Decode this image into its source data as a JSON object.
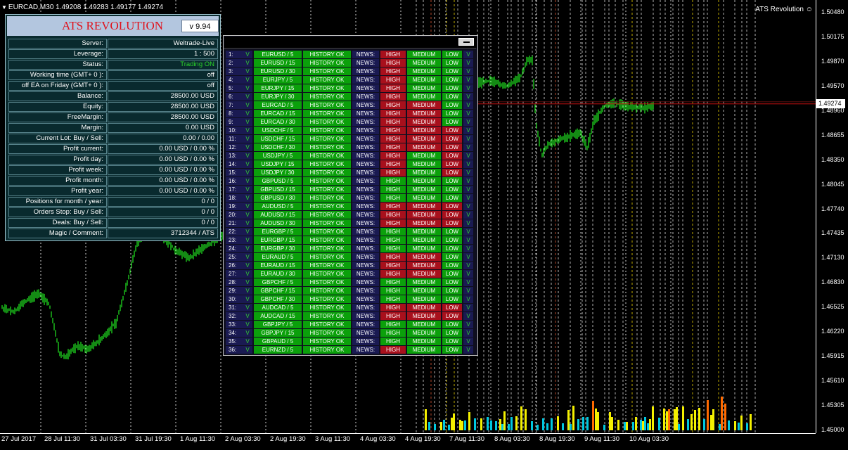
{
  "chart": {
    "symbol_title": "EURCAD,M30  1.49208 1.49283 1.49177 1.49274",
    "indicator_name": "ATS Revolution",
    "indicator_icon": "smiley-icon",
    "current_price": "1.49274",
    "price_labels": [
      "1.50480",
      "1.50175",
      "1.49870",
      "1.49570",
      "1.48960",
      "1.48655",
      "1.48350",
      "1.48045",
      "1.47740",
      "1.47435",
      "1.47130",
      "1.46830",
      "1.46525",
      "1.46220",
      "1.45915",
      "1.45610",
      "1.45305",
      "1.45000"
    ],
    "time_labels": [
      "27 Jul 2017",
      "28 Jul 11:30",
      "31 Jul 03:30",
      "31 Jul 19:30",
      "1 Aug 11:30",
      "2 Aug 03:30",
      "2 Aug 19:30",
      "3 Aug 11:30",
      "4 Aug 03:30",
      "4 Aug 19:30",
      "7 Aug 11:30",
      "8 Aug 03:30",
      "8 Aug 19:30",
      "9 Aug 11:30",
      "10 Aug 03:30"
    ],
    "colors": {
      "candle": "#1fd61f",
      "vline": "#d0d0d0",
      "hist_cyan": "#00c8e0",
      "hist_yellow": "#f4f000",
      "hist_orange": "#ff6a00",
      "price_line": "#c81010"
    }
  },
  "info_panel": {
    "title": "ATS REVOLUTION",
    "version": "v 9.94",
    "rows": [
      {
        "label": "Server:",
        "value": "Weltrade-Live"
      },
      {
        "label": "Leverage:",
        "value": "1 : 500"
      },
      {
        "label": "Status:",
        "value": "Trading ON",
        "status": "on"
      },
      {
        "label": "Working time (GMT+ 0 ):",
        "value": "off"
      },
      {
        "label": "off EA on Friday (GMT+ 0 ):",
        "value": "off"
      },
      {
        "label": "Balance:",
        "value": "28500.00 USD"
      },
      {
        "label": "Equity:",
        "value": "28500.00 USD"
      },
      {
        "label": "FreeMargin:",
        "value": "28500.00 USD"
      },
      {
        "label": "Margin:",
        "value": "0.00 USD"
      },
      {
        "label": "Current Lot:  Buy  /  Sell:",
        "value": "0.00  /  0.00"
      },
      {
        "label": "Profit current:",
        "value": "0.00 USD / 0.00 %"
      },
      {
        "label": "Profit day:",
        "value": "0.00 USD / 0.00 %"
      },
      {
        "label": "Profit week:",
        "value": "0.00 USD / 0.00 %"
      },
      {
        "label": "Profit month:",
        "value": "0.00 USD / 0.00 %"
      },
      {
        "label": "Profit year:",
        "value": "0.00 USD / 0.00 %"
      },
      {
        "label": "Positions for month / year:",
        "value": "0  /  0"
      },
      {
        "label": "Orders Stop: Buy / Sell:",
        "value": "0  /  0"
      },
      {
        "label": "Deals: Buy / Sell:",
        "value": "0  /  0"
      },
      {
        "label": "Magic  /  Comment:",
        "value": "3712344  /  ATS"
      }
    ]
  },
  "symbols_panel": {
    "history_label": "HISTORY  OK",
    "news_label": "NEWS:",
    "high_label": "HIGH",
    "medium_label": "MEDIUM",
    "low_label": "LOW",
    "v_label": "V",
    "colors": {
      "green": "#0ba00b",
      "red": "#a8101c"
    },
    "rows": [
      {
        "num": "1:",
        "sym": "EURUSD / 5",
        "high": "red",
        "med": "green",
        "low": "green"
      },
      {
        "num": "2:",
        "sym": "EURUSD / 15",
        "high": "red",
        "med": "green",
        "low": "green"
      },
      {
        "num": "3:",
        "sym": "EURUSD / 30",
        "high": "red",
        "med": "green",
        "low": "green"
      },
      {
        "num": "4:",
        "sym": "EURJPY / 5",
        "high": "red",
        "med": "green",
        "low": "green"
      },
      {
        "num": "5:",
        "sym": "EURJPY / 15",
        "high": "red",
        "med": "green",
        "low": "green"
      },
      {
        "num": "6:",
        "sym": "EURJPY / 30",
        "high": "red",
        "med": "green",
        "low": "green"
      },
      {
        "num": "7:",
        "sym": "EURCAD / 5",
        "high": "red",
        "med": "red",
        "low": "green"
      },
      {
        "num": "8:",
        "sym": "EURCAD / 15",
        "high": "red",
        "med": "red",
        "low": "green"
      },
      {
        "num": "9:",
        "sym": "EURCAD / 30",
        "high": "red",
        "med": "red",
        "low": "green"
      },
      {
        "num": "10:",
        "sym": "USDCHF / 5",
        "high": "red",
        "med": "red",
        "low": "red"
      },
      {
        "num": "11:",
        "sym": "USDCHF / 15",
        "high": "red",
        "med": "red",
        "low": "red"
      },
      {
        "num": "12:",
        "sym": "USDCHF / 30",
        "high": "red",
        "med": "red",
        "low": "red"
      },
      {
        "num": "13:",
        "sym": "USDJPY / 5",
        "high": "red",
        "med": "green",
        "low": "red"
      },
      {
        "num": "14:",
        "sym": "USDJPY / 15",
        "high": "red",
        "med": "green",
        "low": "red"
      },
      {
        "num": "15:",
        "sym": "USDJPY / 30",
        "high": "red",
        "med": "green",
        "low": "red"
      },
      {
        "num": "16:",
        "sym": "GBPUSD / 5",
        "high": "green",
        "med": "green",
        "low": "green"
      },
      {
        "num": "17:",
        "sym": "GBPUSD / 15",
        "high": "green",
        "med": "green",
        "low": "green"
      },
      {
        "num": "18:",
        "sym": "GBPUSD / 30",
        "high": "green",
        "med": "green",
        "low": "green"
      },
      {
        "num": "19:",
        "sym": "AUDUSD / 5",
        "high": "red",
        "med": "red",
        "low": "red"
      },
      {
        "num": "20:",
        "sym": "AUDUSD / 15",
        "high": "red",
        "med": "red",
        "low": "red"
      },
      {
        "num": "21:",
        "sym": "AUDUSD / 30",
        "high": "red",
        "med": "red",
        "low": "red"
      },
      {
        "num": "22:",
        "sym": "EURGBP / 5",
        "high": "green",
        "med": "green",
        "low": "green"
      },
      {
        "num": "23:",
        "sym": "EURGBP / 15",
        "high": "green",
        "med": "green",
        "low": "green"
      },
      {
        "num": "24:",
        "sym": "EURGBP / 30",
        "high": "green",
        "med": "green",
        "low": "green"
      },
      {
        "num": "25:",
        "sym": "EURAUD / 5",
        "high": "red",
        "med": "red",
        "low": "green"
      },
      {
        "num": "26:",
        "sym": "EURAUD / 15",
        "high": "red",
        "med": "red",
        "low": "green"
      },
      {
        "num": "27:",
        "sym": "EURAUD / 30",
        "high": "red",
        "med": "red",
        "low": "green"
      },
      {
        "num": "28:",
        "sym": "GBPCHF / 5",
        "high": "green",
        "med": "green",
        "low": "green"
      },
      {
        "num": "29:",
        "sym": "GBPCHF / 15",
        "high": "green",
        "med": "green",
        "low": "green"
      },
      {
        "num": "30:",
        "sym": "GBPCHF / 30",
        "high": "green",
        "med": "green",
        "low": "green"
      },
      {
        "num": "31:",
        "sym": "AUDCAD / 5",
        "high": "red",
        "med": "red",
        "low": "red"
      },
      {
        "num": "32:",
        "sym": "AUDCAD / 15",
        "high": "red",
        "med": "red",
        "low": "red"
      },
      {
        "num": "33:",
        "sym": "GBPJPY / 5",
        "high": "green",
        "med": "green",
        "low": "green"
      },
      {
        "num": "34:",
        "sym": "GBPJPY / 15",
        "high": "green",
        "med": "green",
        "low": "green"
      },
      {
        "num": "35:",
        "sym": "GBPAUD / 5",
        "high": "green",
        "med": "green",
        "low": "green"
      },
      {
        "num": "36:",
        "sym": "EURNZD / 5",
        "high": "red",
        "med": "green",
        "low": "green"
      }
    ]
  }
}
